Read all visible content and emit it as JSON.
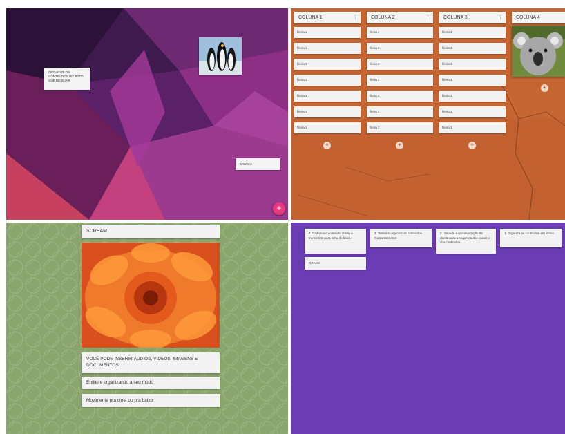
{
  "canvas_panel": {
    "note_organize": "ORGANIZE OS CONTEÚDOS DO JEITO QUE DESEJAR",
    "note_canvas": "CANVAS",
    "add_button": "+",
    "penguin_image": "penguins-photo"
  },
  "columns_panel": {
    "columns": [
      {
        "title": "COLUNA 1",
        "menu": "⋮",
        "rows": [
          "fileira 1",
          "fileira 1",
          "fileira 1",
          "fileira 1",
          "fileira 1",
          "fileira 1",
          "fileira 1"
        ]
      },
      {
        "title": "COLUNA 2",
        "menu": "⋮",
        "rows": [
          "fileira 2",
          "fileira 2",
          "fileira 2",
          "fileira 2",
          "fileira 2",
          "fileira 2",
          "fileira 2"
        ]
      },
      {
        "title": "COLUNA 3",
        "menu": "⋮",
        "rows": [
          "fileira 3",
          "fileira 3",
          "fileira 3",
          "fileira 3",
          "fileira 3",
          "fileira 3",
          "fileira 3"
        ]
      },
      {
        "title": "COLUNA 4",
        "menu": "",
        "rows": []
      }
    ],
    "add_label": "+",
    "koala_image": "koala-photo"
  },
  "stream_panel": {
    "title": "SCREAM",
    "flower_image": "orange-flower-photo",
    "caption_1": "VOCÊ PODE INSERIR ÁUDIOS, VIDEOS, IMAGENS E DOCUMENTOS",
    "caption_2": "Enfileire organizando a seu modo",
    "caption_3": "Movimente pra cima ou pra baixo"
  },
  "grid_panel": {
    "card_4": "4. Cada novo conteúdo criado é transferido para linha de baixo.",
    "card_3": "3. Também organiza os conteúdos horizontalmente",
    "card_2": "2 . Impede a movimentação da direita para a esquerda das caixas e dos conteúdos",
    "card_1": "1. Organiza os conteúdos em linhas",
    "card_grade": "GRADE"
  },
  "colors": {
    "fab_pink": "#e9387d",
    "purple_bg": "#6a3db5",
    "dirt_bg": "#c96a37",
    "green_bg": "#8aa56d"
  }
}
